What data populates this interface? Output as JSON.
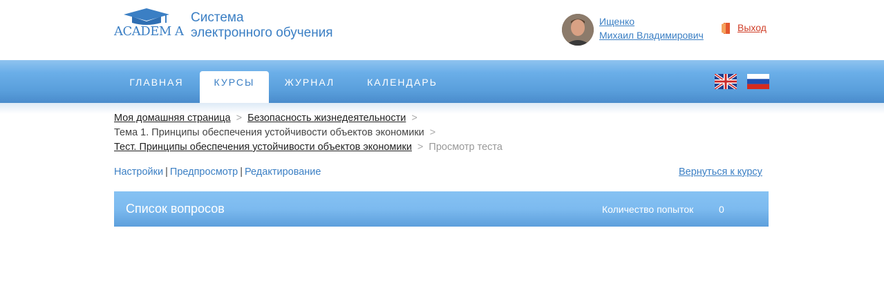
{
  "header": {
    "logo_text": "ACADEM A",
    "site_title_line1": "Система",
    "site_title_line2": "электронного обучения",
    "user_first_line": "Ищенко",
    "user_second_line": "Михаил Владимирович",
    "logout_label": "Выход"
  },
  "nav": {
    "items": [
      {
        "label": "ГЛАВНАЯ",
        "active": false
      },
      {
        "label": "КУРСЫ",
        "active": true
      },
      {
        "label": "ЖУРНАЛ",
        "active": false
      },
      {
        "label": "КАЛЕНДАРЬ",
        "active": false
      }
    ],
    "languages": [
      "en-flag-icon",
      "ru-flag-icon"
    ]
  },
  "breadcrumb": {
    "home": "Моя домашняя страница",
    "course": "Безопасность жизнедеятельности",
    "topic": "Тема 1. Принципы обеспечения устойчивости объектов экономики",
    "test": "Тест. Принципы обеспечения устойчивости объектов экономики",
    "current": "Просмотр теста",
    "separator": ">"
  },
  "actions": {
    "settings": "Настройки",
    "preview": "Предпросмотр",
    "edit": "Редактирование",
    "pipe": "|",
    "back": "Вернуться к курсу"
  },
  "questions_panel": {
    "title": "Список вопросов",
    "attempts_label": "Количество попыток",
    "attempts_value": "0"
  },
  "colors": {
    "accent": "#3b7fc4",
    "logout": "#d0402a",
    "nav_blue": "#5a9fdc"
  }
}
